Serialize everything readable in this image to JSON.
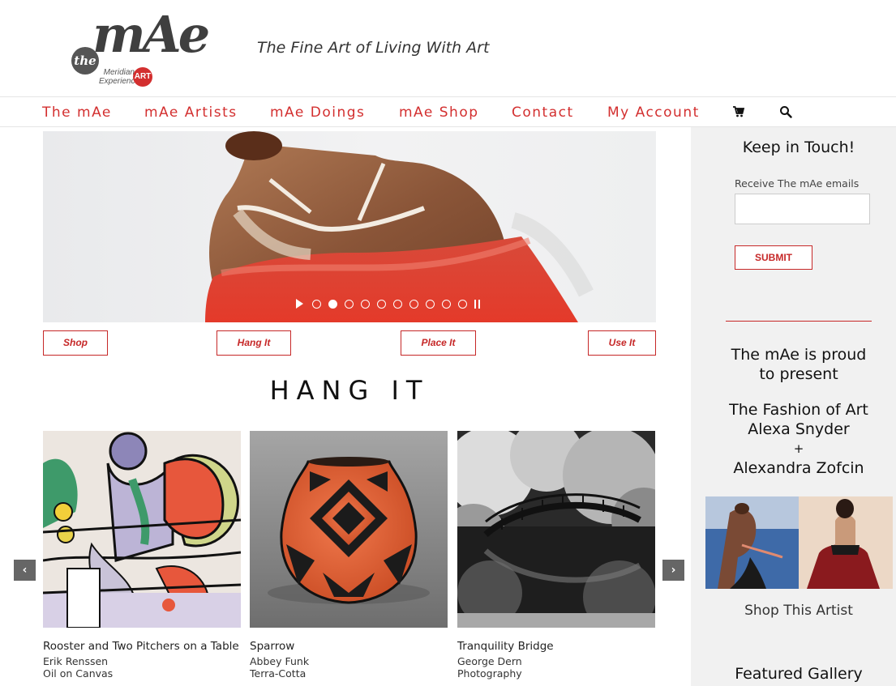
{
  "header": {
    "logo": {
      "the": "the",
      "mae": "mAe",
      "meridian": "Meridian",
      "experience": "Experience",
      "art": "ART"
    },
    "tagline": "The Fine Art of Living With Art"
  },
  "nav": {
    "items": [
      {
        "label": "The mAe"
      },
      {
        "label": "mAe Artists"
      },
      {
        "label": "mAe Doings"
      },
      {
        "label": "mAe Shop"
      },
      {
        "label": "Contact"
      },
      {
        "label": "My Account"
      }
    ],
    "cart_icon": "cart-icon",
    "search_icon": "search-icon"
  },
  "hero": {
    "slides_count": 10,
    "active_slide": 2
  },
  "buttons": {
    "shop": "Shop",
    "hang": "Hang It",
    "place": "Place It",
    "use": "Use It"
  },
  "section_title": "HANG IT",
  "carousel": {
    "prev": "‹",
    "next": "›",
    "items": [
      {
        "title": "Rooster and Two Pitchers on a Table",
        "artist": "Erik Renssen",
        "medium": "Oil on Canvas"
      },
      {
        "title": "Sparrow",
        "artist": "Abbey Funk",
        "medium": "Terra-Cotta"
      },
      {
        "title": "Tranquility Bridge",
        "artist": "George Dern",
        "medium": "Photography"
      }
    ]
  },
  "sidebar": {
    "keep_in_touch": "Keep in Touch!",
    "email_label": "Receive The mAe emails",
    "email_value": "",
    "submit": "SUBMIT",
    "promo_line1": "The mAe is proud",
    "promo_line2": "to present",
    "promo_title": "The Fashion of Art",
    "artist1": "Alexa Snyder",
    "plus": "+",
    "artist2": "Alexandra Zofcin",
    "shop_artist": "Shop This Artist",
    "featured_gallery": "Featured Gallery"
  },
  "colors": {
    "accent": "#d32f2f",
    "sidebar_bg": "#f1f1f1"
  }
}
